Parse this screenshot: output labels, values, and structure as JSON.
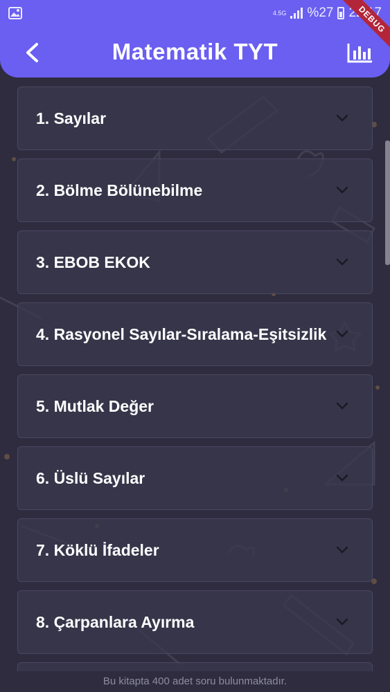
{
  "status_bar": {
    "network": "4.5G",
    "battery": "%27",
    "time": "22:17"
  },
  "debug_label": "DEBUG",
  "app_bar": {
    "title": "Matematik TYT",
    "back_icon": "back-arrow-icon",
    "stats_icon": "bar-chart-icon"
  },
  "topics": [
    {
      "label": "1. Sayılar"
    },
    {
      "label": "2. Bölme Bölünebilme"
    },
    {
      "label": "3. EBOB EKOK"
    },
    {
      "label": "4. Rasyonel Sayılar-Sıralama-Eşitsizlik"
    },
    {
      "label": "5. Mutlak Değer"
    },
    {
      "label": "6. Üslü Sayılar"
    },
    {
      "label": "7. Köklü İfadeler"
    },
    {
      "label": "8. Çarpanlara Ayırma"
    }
  ],
  "footer": {
    "text": "Bu kitapta 400 adet soru bulunmaktadır."
  },
  "colors": {
    "primary": "#6a5ff0",
    "background": "#2e2c3e",
    "card": "#3a384e"
  }
}
